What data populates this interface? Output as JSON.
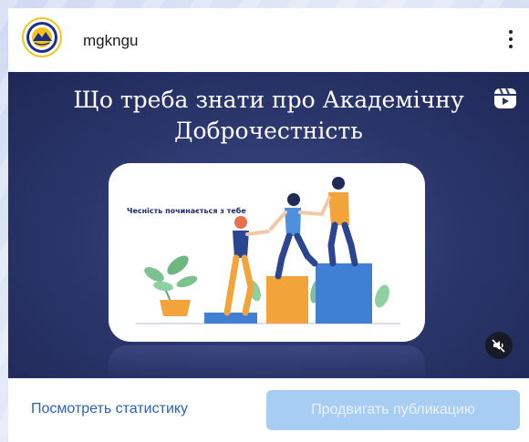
{
  "post": {
    "username": "mgkngu",
    "avatar_icon": "university-logo-icon",
    "more_icon": "more-vertical-icon"
  },
  "media": {
    "title_line1": "Що треба знати про Академічну",
    "title_line2": "Доброчестність",
    "slide_caption": "Чесність починається з тебе",
    "reel_icon": "reels-icon",
    "mute_icon": "muted-speaker-icon",
    "background_color": "#2a356a"
  },
  "actions": {
    "view_stats_label": "Посмотреть статистику",
    "promote_label": "Продвигать публикацию",
    "link_color": "#2a62b8",
    "promote_color": "#a8cdf3"
  }
}
